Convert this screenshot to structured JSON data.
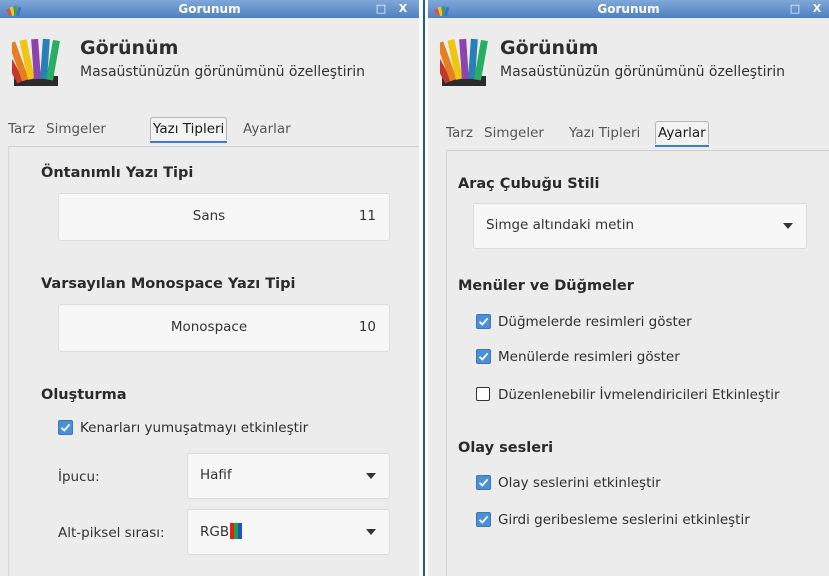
{
  "left_window": {
    "title": "Gorunum",
    "header": {
      "title": "Görünüm",
      "subtitle": "Masaüstünüzün görünümünü özelleştirin"
    },
    "tabs": [
      {
        "label": "Tarz",
        "active": false
      },
      {
        "label": "Simgeler",
        "active": false
      },
      {
        "label": "Yazı Tipleri",
        "active": true
      },
      {
        "label": "Ayarlar",
        "active": false
      }
    ],
    "default_font": {
      "heading": "Öntanımlı Yazı Tipi",
      "name": "Sans",
      "size": "11"
    },
    "monospace_font": {
      "heading": "Varsayılan Monospace Yazı Tipi",
      "name": "Monospace",
      "size": "10"
    },
    "rendering": {
      "heading": "Oluşturma",
      "antialias": {
        "label": "Kenarları yumuşatmayı etkinleştir",
        "checked": true
      },
      "hinting": {
        "label": "İpucu:",
        "value": "Hafif"
      },
      "subpixel": {
        "label": "Alt-piksel sırası:",
        "value": "RGB"
      }
    }
  },
  "right_window": {
    "title": "Gorunum",
    "header": {
      "title": "Görünüm",
      "subtitle": "Masaüstünüzün görünümünü özelleştirin"
    },
    "tabs": [
      {
        "label": "Tarz",
        "active": false
      },
      {
        "label": "Simgeler",
        "active": false
      },
      {
        "label": "Yazı Tipleri",
        "active": false
      },
      {
        "label": "Ayarlar",
        "active": true
      }
    ],
    "toolbar_style": {
      "heading": "Araç Çubuğu Stili",
      "value": "Simge altındaki metin"
    },
    "menus_buttons": {
      "heading": "Menüler ve Düğmeler",
      "items": [
        {
          "label": "Düğmelerde resimleri göster",
          "checked": true
        },
        {
          "label": "Menülerde resimleri göster",
          "checked": true
        },
        {
          "label": "Düzenlenebilir İvmelendiricileri Etkinleştir",
          "checked": false
        }
      ]
    },
    "event_sounds": {
      "heading": "Olay sesleri",
      "items": [
        {
          "label": "Olay seslerini etkinleştir",
          "checked": true
        },
        {
          "label": "Girdi geribesleme seslerini etkinleştir",
          "checked": true
        }
      ]
    }
  },
  "colors": {
    "accent": "#4a90d9",
    "titlebar": "#5f8fcb",
    "divider": "#1e5aa0"
  },
  "icons": {
    "app": "palette-icon",
    "maximize": "maximize-icon",
    "close": "close-icon",
    "dropdown": "chevron-down-icon"
  }
}
